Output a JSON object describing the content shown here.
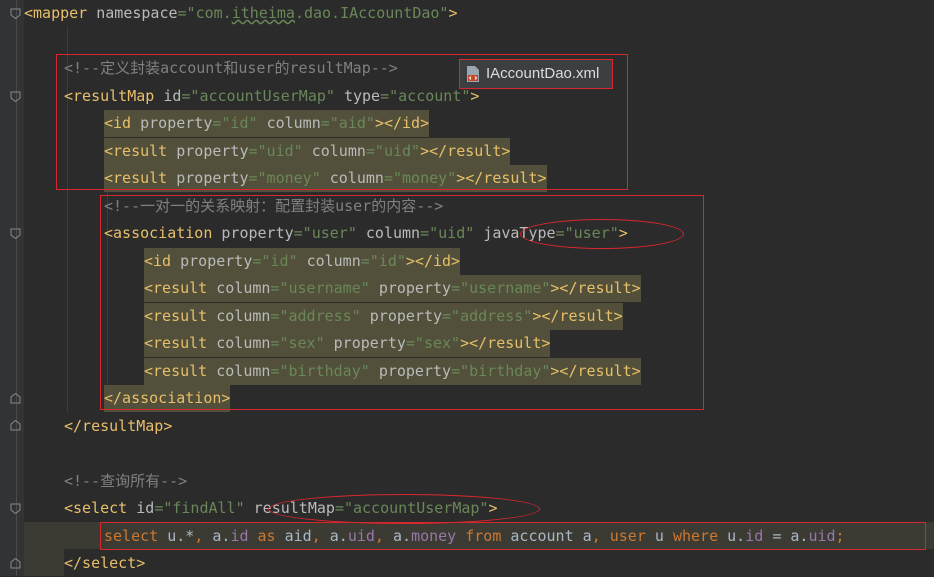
{
  "editor": {
    "file_tab": {
      "name": "IAccountDao.xml"
    },
    "lines": {
      "mapper_open": [
        [
          "<mapper ",
          "t"
        ],
        [
          "namespace",
          "a"
        ],
        [
          "=\"com.",
          "v"
        ],
        [
          "itheima",
          "v squiggle"
        ],
        [
          ".dao.IAccountDao\"",
          "v"
        ],
        [
          ">",
          "t"
        ]
      ],
      "cmt_resultmap": [
        [
          "<!--定义封装account和user的resultMap-->",
          "c"
        ]
      ],
      "resultmap_open": [
        [
          "<resultMap ",
          "t"
        ],
        [
          "id",
          "a"
        ],
        [
          "=\"accountUserMap\" ",
          "v"
        ],
        [
          "type",
          "a"
        ],
        [
          "=\"account\"",
          "v"
        ],
        [
          ">",
          "t"
        ]
      ],
      "id_aid": [
        [
          "<id ",
          "t"
        ],
        [
          "property",
          "a"
        ],
        [
          "=\"id\" ",
          "v"
        ],
        [
          "column",
          "a"
        ],
        [
          "=\"aid\"",
          "v"
        ],
        [
          "></id>",
          "t"
        ]
      ],
      "result_uid": [
        [
          "<result ",
          "t"
        ],
        [
          "property",
          "a"
        ],
        [
          "=\"uid\" ",
          "v"
        ],
        [
          "column",
          "a"
        ],
        [
          "=\"uid\"",
          "v"
        ],
        [
          "></result>",
          "t"
        ]
      ],
      "result_money": [
        [
          "<result ",
          "t"
        ],
        [
          "property",
          "a"
        ],
        [
          "=\"money\" ",
          "v"
        ],
        [
          "column",
          "a"
        ],
        [
          "=\"money\"",
          "v"
        ],
        [
          "></result>",
          "t"
        ]
      ],
      "cmt_onetoone": [
        [
          "<!--一对一的关系映射：配置封装user的内容-->",
          "c"
        ]
      ],
      "association_open": [
        [
          "<association ",
          "t"
        ],
        [
          "property",
          "a"
        ],
        [
          "=\"user\" ",
          "v"
        ],
        [
          "column",
          "a"
        ],
        [
          "=\"uid\" ",
          "v"
        ],
        [
          "javaType",
          "a"
        ],
        [
          "=\"user\"",
          "v"
        ],
        [
          ">",
          "t"
        ]
      ],
      "assoc_id": [
        [
          "<id ",
          "t"
        ],
        [
          "property",
          "a"
        ],
        [
          "=\"id\" ",
          "v"
        ],
        [
          "column",
          "a"
        ],
        [
          "=\"id\"",
          "v"
        ],
        [
          "></id>",
          "t"
        ]
      ],
      "assoc_username": [
        [
          "<result ",
          "t"
        ],
        [
          "column",
          "a"
        ],
        [
          "=\"username\" ",
          "v"
        ],
        [
          "property",
          "a"
        ],
        [
          "=\"username\"",
          "v"
        ],
        [
          "></result>",
          "t"
        ]
      ],
      "assoc_address": [
        [
          "<result ",
          "t"
        ],
        [
          "column",
          "a"
        ],
        [
          "=\"address\" ",
          "v"
        ],
        [
          "property",
          "a"
        ],
        [
          "=\"address\"",
          "v"
        ],
        [
          "></result>",
          "t"
        ]
      ],
      "assoc_sex": [
        [
          "<result ",
          "t"
        ],
        [
          "column",
          "a"
        ],
        [
          "=\"sex\" ",
          "v"
        ],
        [
          "property",
          "a"
        ],
        [
          "=\"sex\"",
          "v"
        ],
        [
          "></result>",
          "t"
        ]
      ],
      "assoc_birthday": [
        [
          "<result ",
          "t"
        ],
        [
          "column",
          "a"
        ],
        [
          "=\"birthday\" ",
          "v"
        ],
        [
          "property",
          "a"
        ],
        [
          "=\"birthday\"",
          "v"
        ],
        [
          "></result>",
          "t"
        ]
      ],
      "association_close": [
        [
          "</association>",
          "t"
        ]
      ],
      "resultmap_close": [
        [
          "</resultMap>",
          "t"
        ]
      ],
      "cmt_query": [
        [
          "<!--查询所有-->",
          "c"
        ]
      ],
      "select_open": [
        [
          "<select ",
          "t"
        ],
        [
          "id",
          "a"
        ],
        [
          "=\"findAll\" ",
          "v"
        ],
        [
          "resultMap",
          "a"
        ],
        [
          "=\"accountUserMap\"",
          "v"
        ],
        [
          ">",
          "t"
        ]
      ],
      "sql_line": [
        [
          "select ",
          "k"
        ],
        [
          "u.*",
          "p"
        ],
        [
          ", ",
          "k"
        ],
        [
          "a.",
          "p"
        ],
        [
          "id ",
          "f"
        ],
        [
          "as ",
          "k"
        ],
        [
          "aid",
          "p"
        ],
        [
          ", ",
          "k"
        ],
        [
          "a.",
          "p"
        ],
        [
          "uid",
          "f"
        ],
        [
          ", ",
          "k"
        ],
        [
          "a.",
          "p"
        ],
        [
          "money ",
          "f"
        ],
        [
          "from ",
          "k"
        ],
        [
          "account a",
          "p"
        ],
        [
          ", ",
          "k"
        ],
        [
          "user ",
          "k"
        ],
        [
          "u ",
          "p"
        ],
        [
          "where ",
          "k"
        ],
        [
          "u.",
          "p"
        ],
        [
          "id ",
          "f"
        ],
        [
          "= ",
          "p"
        ],
        [
          "a.",
          "p"
        ],
        [
          "uid",
          "f"
        ],
        [
          ";",
          "k"
        ]
      ],
      "select_close": [
        [
          "</select>",
          "t"
        ]
      ]
    }
  },
  "colors": {
    "background": "#2b2b2b",
    "tag": "#e8bf6a",
    "attribute": "#bababa",
    "value": "#6a8759",
    "comment": "#808080",
    "keyword": "#cc7832",
    "field": "#9876aa",
    "annotation_red": "#d9272e"
  }
}
